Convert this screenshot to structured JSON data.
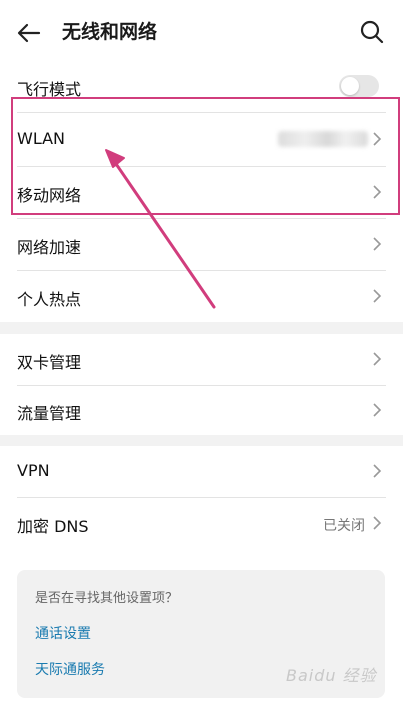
{
  "header": {
    "title": "无线和网络"
  },
  "sections": [
    {
      "items": [
        {
          "label": "飞行模式",
          "control": "toggle",
          "checked": false
        },
        {
          "label": "WLAN",
          "value_obscured": true
        },
        {
          "label": "移动网络"
        },
        {
          "label": "网络加速"
        },
        {
          "label": "个人热点"
        }
      ]
    },
    {
      "items": [
        {
          "label": "双卡管理"
        },
        {
          "label": "流量管理"
        }
      ]
    },
    {
      "items": [
        {
          "label": "VPN"
        },
        {
          "label": "加密 DNS",
          "value": "已关闭"
        }
      ]
    }
  ],
  "suggest_card": {
    "prompt": "是否在寻找其他设置项？",
    "links": [
      "通话设置",
      "天际通服务"
    ]
  },
  "annotation": {
    "color": "#d13d7d",
    "type": "highlight-box-and-arrow"
  },
  "watermark": "Baidu 经验",
  "colors": {
    "link": "#1a7bb0",
    "highlight": "#d13d7d",
    "section_gap": "#f2f2f2"
  },
  "icons": [
    "back-arrow-icon",
    "search-icon",
    "chevron-right-icon"
  ]
}
